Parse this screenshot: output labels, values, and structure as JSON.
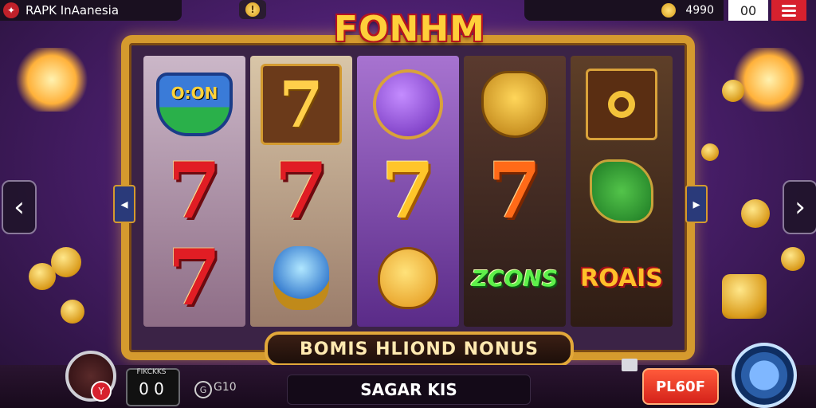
{
  "top_bar": {
    "app_title": "RAPK  InAanesia",
    "coin_button_label": "!",
    "balance": "4990",
    "score": "00"
  },
  "game": {
    "title": "FONHM",
    "reel_badges": {
      "shield_text": "O:ON",
      "zcons": "ZCONS",
      "roais": "ROAIS"
    },
    "bonus_banner": "BOMIS HLIOND NONUS"
  },
  "bottom_bar": {
    "lines_label": "FIKCKKS",
    "lines_value": "0 0",
    "g_text": "G10",
    "g_icon": "G",
    "center_text": "SAGAR KIS",
    "play_button": "PL60F",
    "gift_badge": "Y"
  },
  "navigation": {
    "left_arrow": "‹",
    "right_arrow": "›"
  },
  "colors": {
    "accent_gold": "#d59a2e",
    "menu_red": "#d7212e",
    "background_purple": "#4b1f6e"
  }
}
